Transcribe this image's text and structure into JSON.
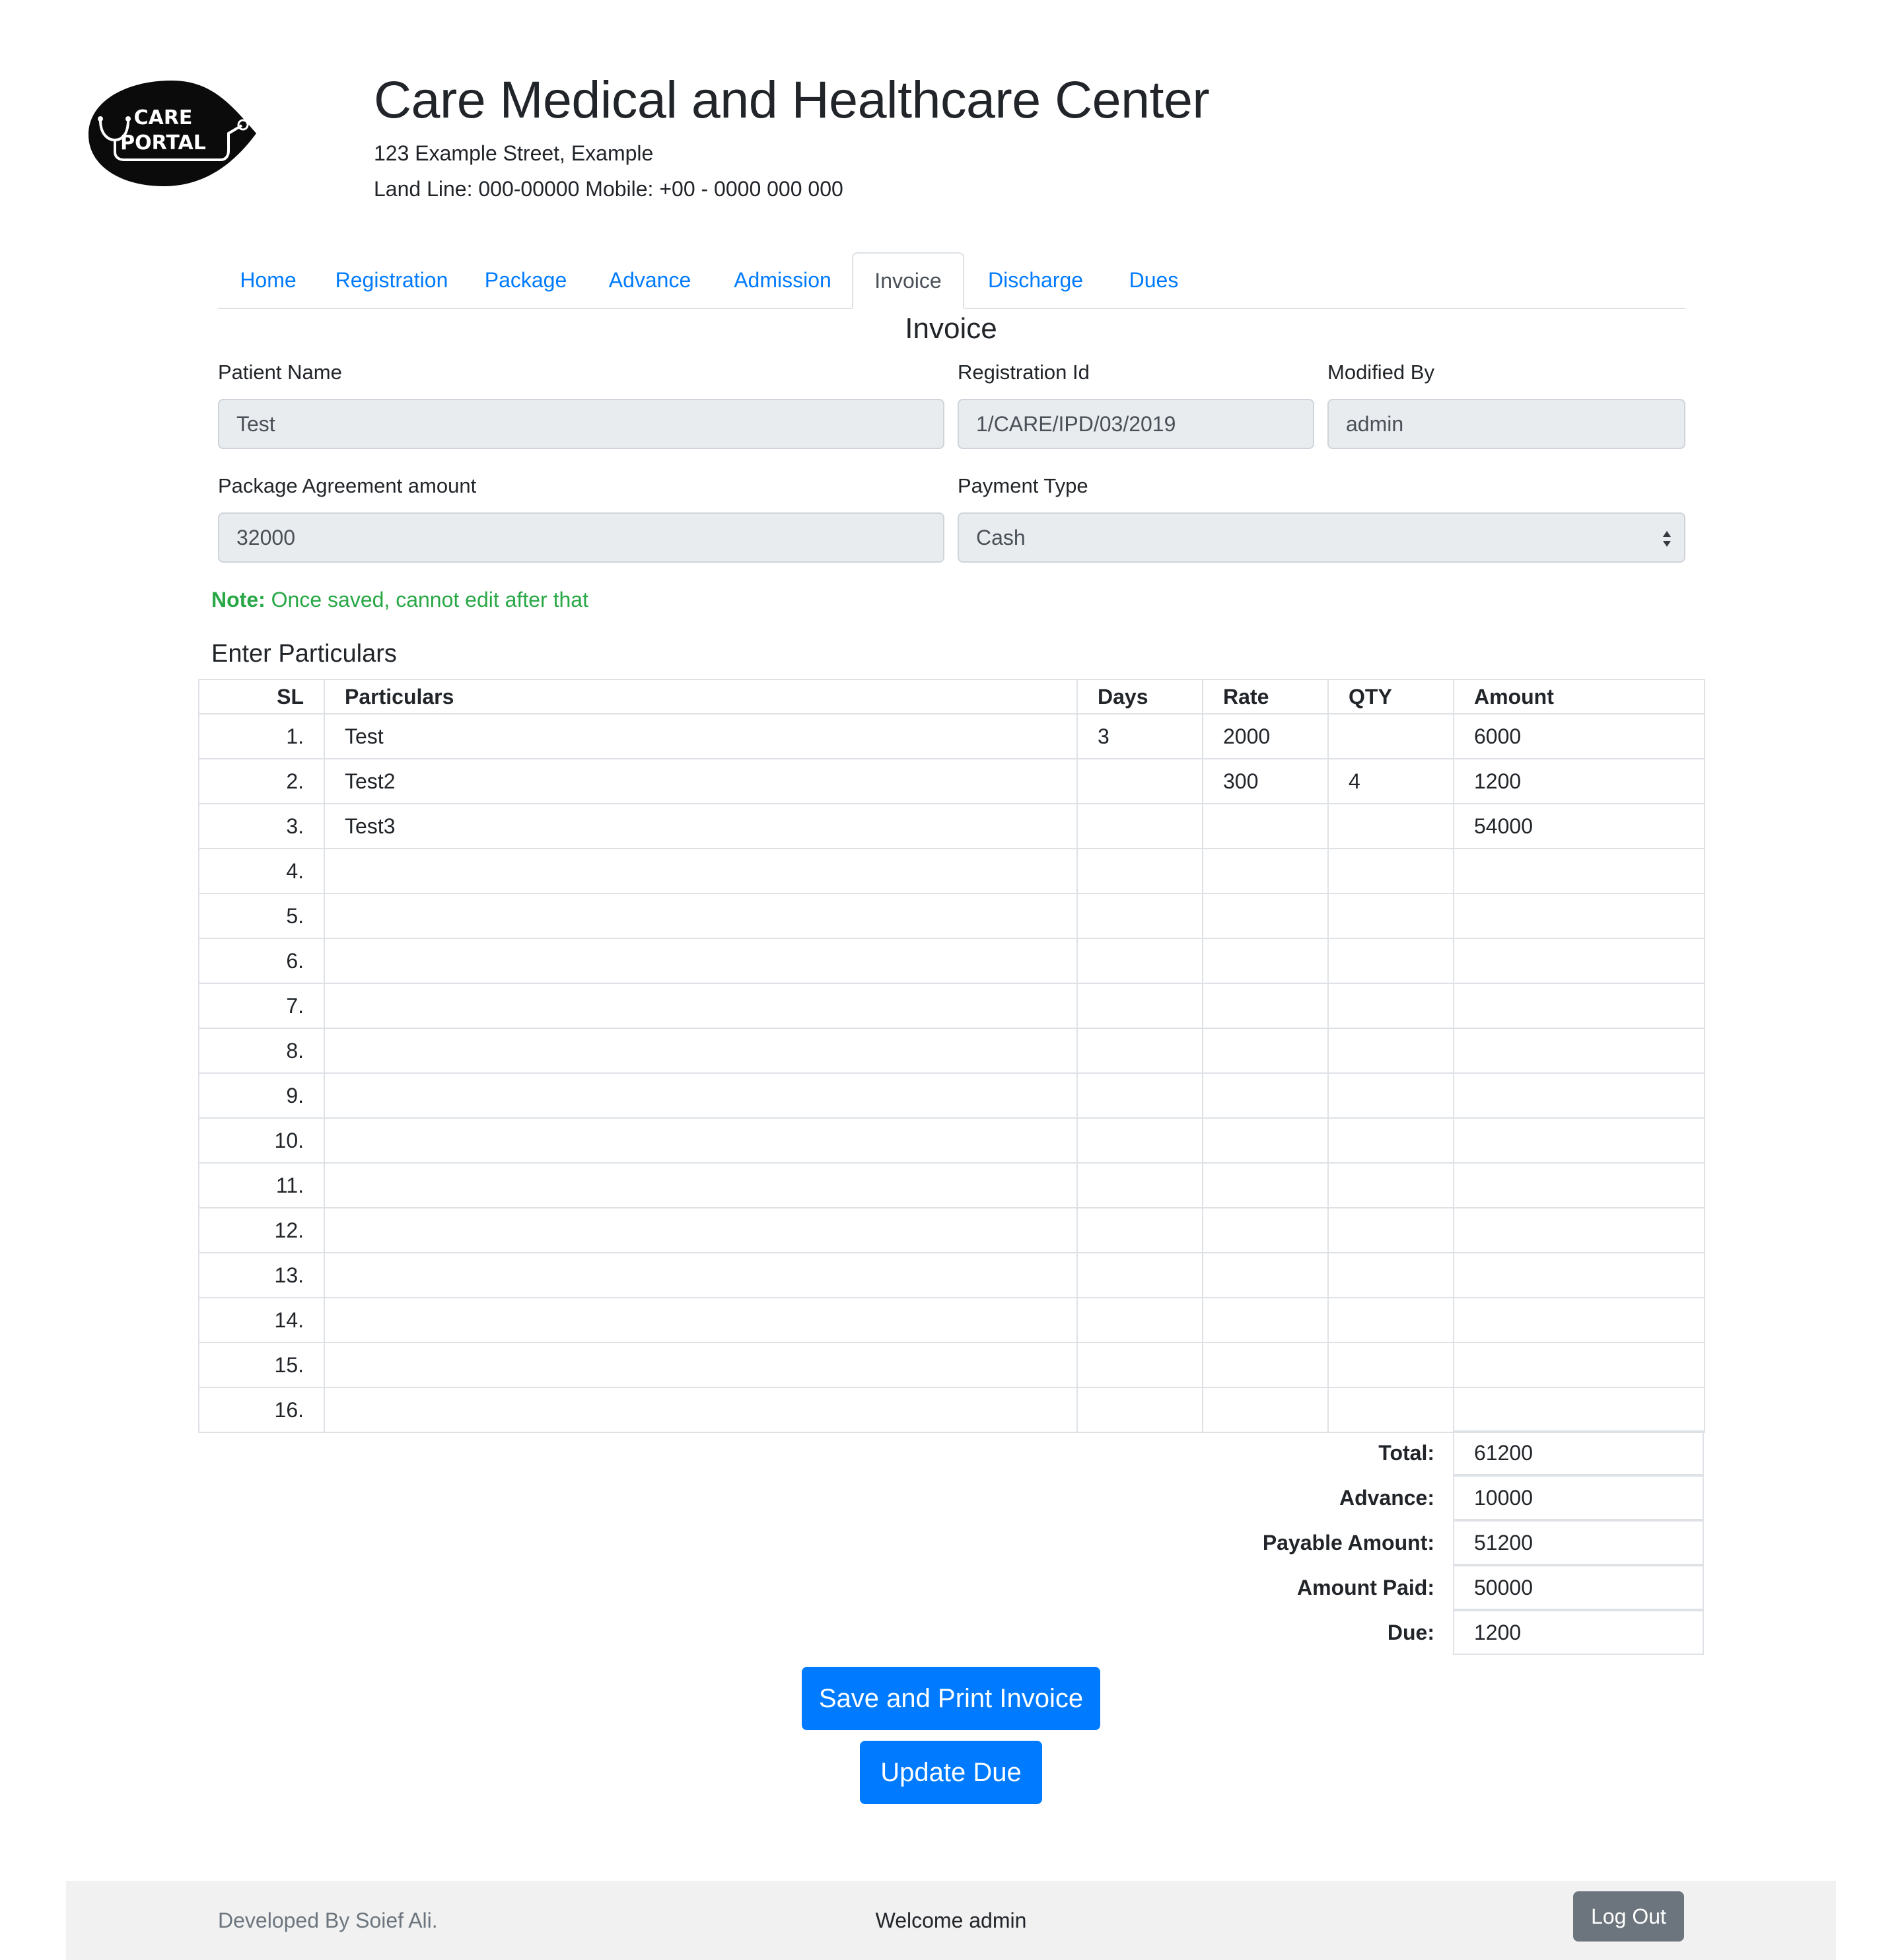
{
  "header": {
    "logo_text_line1": "CARE",
    "logo_text_line2": "PORTAL",
    "clinic_name": "Care Medical and Healthcare Center",
    "address": "123 Example Street, Example",
    "phones": "Land Line: 000-00000 Mobile: +00 - 0000 000 000"
  },
  "nav": {
    "tabs": [
      {
        "label": "Home"
      },
      {
        "label": "Registration"
      },
      {
        "label": "Package"
      },
      {
        "label": "Advance"
      },
      {
        "label": "Admission"
      },
      {
        "label": "Invoice",
        "active": true
      },
      {
        "label": "Discharge"
      },
      {
        "label": "Dues"
      }
    ]
  },
  "form": {
    "title": "Invoice",
    "patient_name_label": "Patient Name",
    "patient_name_value": "Test",
    "registration_id_label": "Registration Id",
    "registration_id_value": "1/CARE/IPD/03/2019",
    "modified_by_label": "Modified By",
    "modified_by_value": "admin",
    "package_amount_label": "Package Agreement amount",
    "package_amount_value": "32000",
    "payment_type_label": "Payment Type",
    "payment_type_value": "Cash",
    "note_prefix": "Note:",
    "note_text": "Once saved, cannot edit after that",
    "particulars_heading": "Enter Particulars"
  },
  "table": {
    "columns": [
      "SL",
      "Particulars",
      "Days",
      "Rate",
      "QTY",
      "Amount"
    ],
    "rows": [
      [
        "1.",
        "Test",
        "3",
        "2000",
        "",
        "6000"
      ],
      [
        "2.",
        "Test2",
        "",
        "300",
        "4",
        "1200"
      ],
      [
        "3.",
        "Test3",
        "",
        "",
        "",
        "54000"
      ],
      [
        "4.",
        "",
        "",
        "",
        "",
        ""
      ],
      [
        "5.",
        "",
        "",
        "",
        "",
        ""
      ],
      [
        "6.",
        "",
        "",
        "",
        "",
        ""
      ],
      [
        "7.",
        "",
        "",
        "",
        "",
        ""
      ],
      [
        "8.",
        "",
        "",
        "",
        "",
        ""
      ],
      [
        "9.",
        "",
        "",
        "",
        "",
        ""
      ],
      [
        "10.",
        "",
        "",
        "",
        "",
        ""
      ],
      [
        "11.",
        "",
        "",
        "",
        "",
        ""
      ],
      [
        "12.",
        "",
        "",
        "",
        "",
        ""
      ],
      [
        "13.",
        "",
        "",
        "",
        "",
        ""
      ],
      [
        "14.",
        "",
        "",
        "",
        "",
        ""
      ],
      [
        "15.",
        "",
        "",
        "",
        "",
        ""
      ],
      [
        "16.",
        "",
        "",
        "",
        "",
        ""
      ]
    ]
  },
  "totals": [
    {
      "label": "Total:",
      "value": "61200"
    },
    {
      "label": "Advance:",
      "value": "10000"
    },
    {
      "label": "Payable Amount:",
      "value": "51200"
    },
    {
      "label": "Amount Paid:",
      "value": "50000"
    },
    {
      "label": "Due:",
      "value": "1200"
    }
  ],
  "buttons": {
    "save_print": "Save and Print Invoice",
    "update_due": "Update Due"
  },
  "footer": {
    "credit": "Developed By Soief Ali.",
    "welcome": "Welcome admin",
    "logout": "Log Out"
  },
  "colors": {
    "link": "#007bff",
    "primary_button": "#007bff",
    "note": "#28a745",
    "secondary_button": "#6c757d",
    "readonly_field": "#e9ecef"
  }
}
